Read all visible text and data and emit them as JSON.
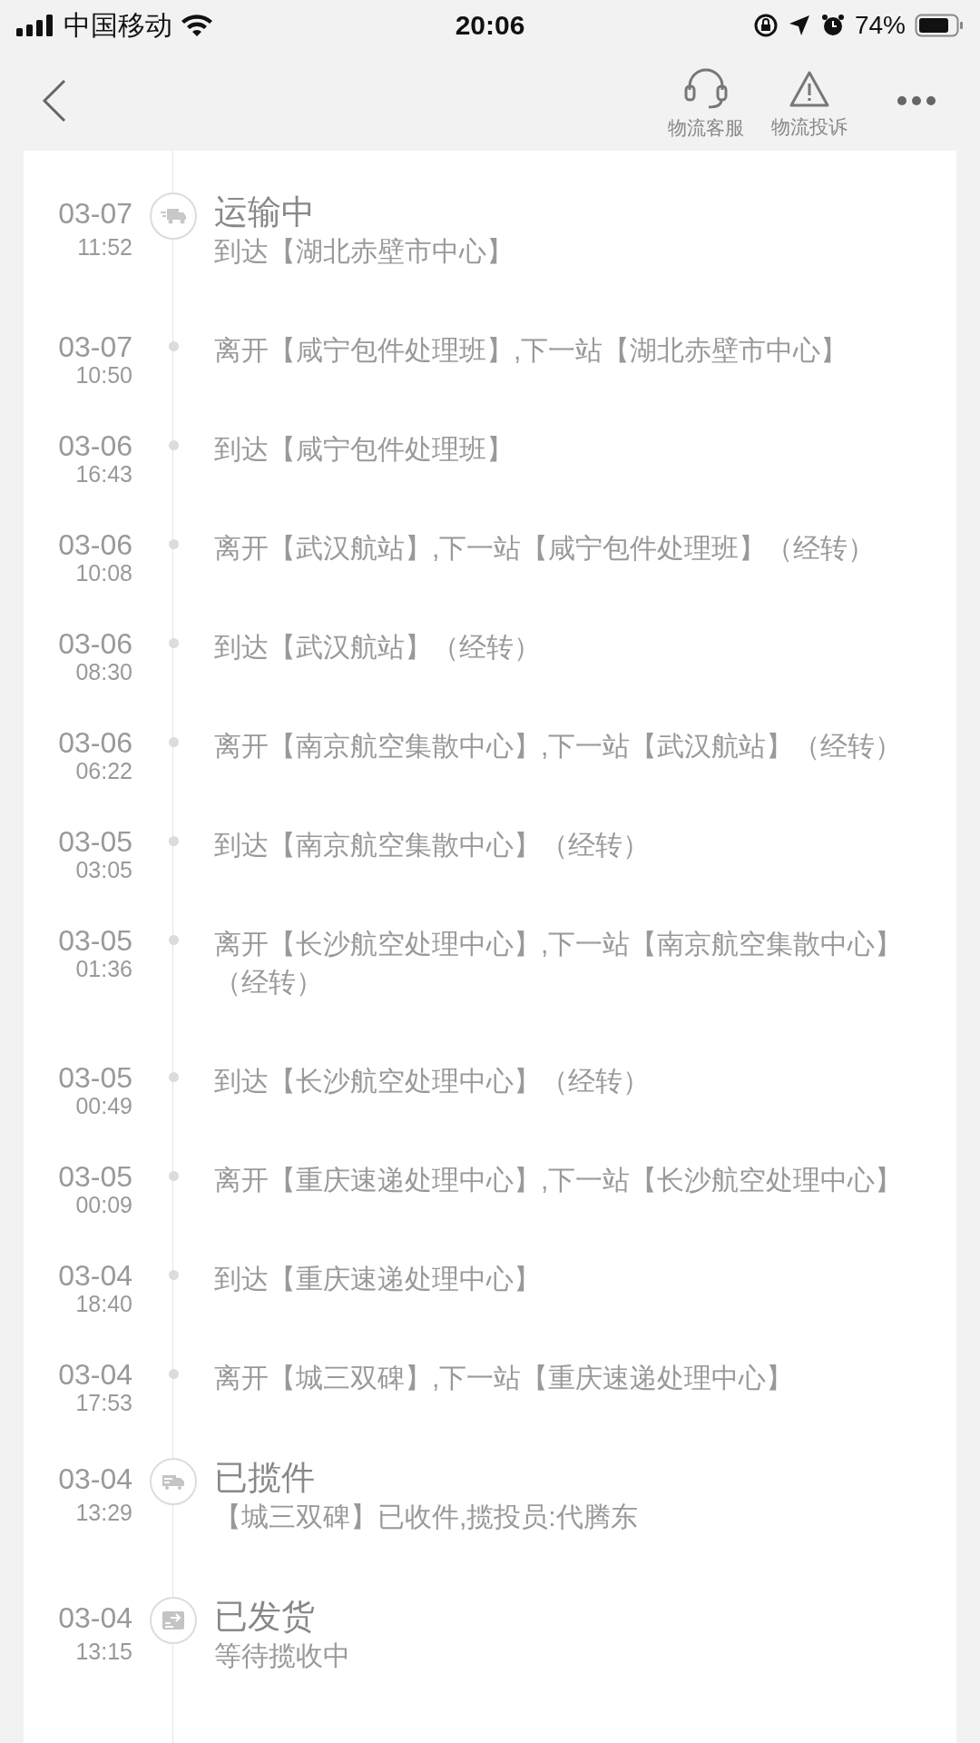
{
  "status_bar": {
    "carrier": "中国移动",
    "time": "20:06",
    "battery": "74%"
  },
  "nav": {
    "actions": [
      {
        "kind": "service",
        "label": "物流客服"
      },
      {
        "kind": "complaint",
        "label": "物流投诉"
      }
    ]
  },
  "events": [
    {
      "kind": "transit",
      "date": "03-07",
      "time": "11:52",
      "title": "运输中",
      "detail": "到达【湖北赤壁市中心】"
    },
    {
      "kind": "step",
      "date": "03-07",
      "time": "10:50",
      "detail": "离开【咸宁包件处理班】,下一站【湖北赤壁市中心】"
    },
    {
      "kind": "step",
      "date": "03-06",
      "time": "16:43",
      "detail": "到达【咸宁包件处理班】"
    },
    {
      "kind": "step",
      "date": "03-06",
      "time": "10:08",
      "detail": "离开【武汉航站】,下一站【咸宁包件处理班】（经转）"
    },
    {
      "kind": "step",
      "date": "03-06",
      "time": "08:30",
      "detail": "到达【武汉航站】（经转）"
    },
    {
      "kind": "step",
      "date": "03-06",
      "time": "06:22",
      "detail": "离开【南京航空集散中心】,下一站【武汉航站】（经转）"
    },
    {
      "kind": "step",
      "date": "03-05",
      "time": "03:05",
      "detail": "到达【南京航空集散中心】（经转）"
    },
    {
      "kind": "step",
      "date": "03-05",
      "time": "01:36",
      "detail": "离开【长沙航空处理中心】,下一站【南京航空集散中心】（经转）"
    },
    {
      "kind": "step",
      "date": "03-05",
      "time": "00:49",
      "detail": "到达【长沙航空处理中心】（经转）"
    },
    {
      "kind": "step",
      "date": "03-05",
      "time": "00:09",
      "detail": "离开【重庆速递处理中心】,下一站【长沙航空处理中心】"
    },
    {
      "kind": "step",
      "date": "03-04",
      "time": "18:40",
      "detail": "到达【重庆速递处理中心】"
    },
    {
      "kind": "step",
      "date": "03-04",
      "time": "17:53",
      "detail": "离开【城三双碑】,下一站【重庆速递处理中心】"
    },
    {
      "kind": "pickup",
      "date": "03-04",
      "time": "13:29",
      "title": "已揽件",
      "detail": "【城三双碑】已收件,揽投员:代腾东"
    },
    {
      "kind": "shipped",
      "date": "03-04",
      "time": "13:15",
      "title": "已发货",
      "detail": "等待揽收中"
    }
  ]
}
